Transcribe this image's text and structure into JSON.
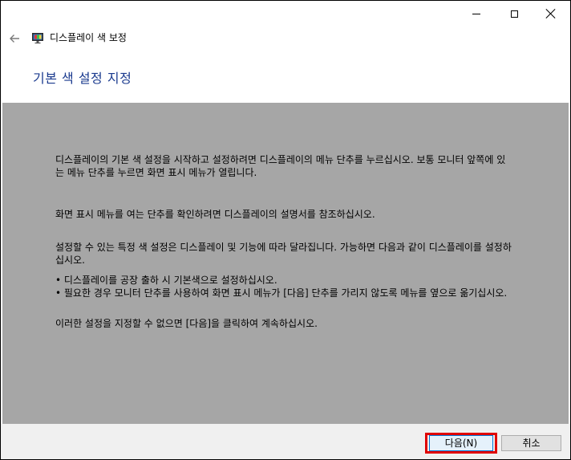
{
  "window": {
    "title": "디스플레이 색 보정",
    "caption_buttons": {
      "minimize_icon": "minimize-icon",
      "maximize_icon": "maximize-icon",
      "close_icon": "close-icon"
    }
  },
  "nav": {
    "back_icon": "back-arrow-icon",
    "app_icon": "display-color-calibration-icon"
  },
  "page": {
    "heading": "기본 색 설정 지정"
  },
  "content": {
    "paragraph1": "디스플레이의 기본 색 설정을 시작하고 설정하려면 디스플레이의 메뉴 단추를 누르십시오. 보통 모니터 앞쪽에 있는 메뉴 단추를 누르면 화면 표시 메뉴가 열립니다.",
    "paragraph2": "화면 표시 메뉴를 여는 단추를 확인하려면 디스플레이의 설명서를 참조하십시오.",
    "paragraph3": "설정할 수 있는 특정 색 설정은 디스플레이 및 기능에 따라 달라집니다. 가능하면 다음과 같이 디스플레이를 설정하십시오.",
    "bullets": [
      "• 디스플레이를 공장 출하 시 기본색으로 설정하십시오.",
      "• 필요한 경우 모니터 단추를 사용하여 화면 표시 메뉴가 [다음] 단추를 가리지 않도록 메뉴를 옆으로 옮기십시오."
    ],
    "paragraph4": "이러한 설정을 지정할 수 없으면 [다음]을 클릭하여 계속하십시오."
  },
  "footer": {
    "next_label": "다음(N)",
    "cancel_label": "취소"
  },
  "colors": {
    "heading": "#1a3a8e",
    "content_background": "#a6a6a6",
    "footer_background": "#f0f0f0",
    "highlight": "#e00000",
    "default_button_border": "#0078d7"
  }
}
